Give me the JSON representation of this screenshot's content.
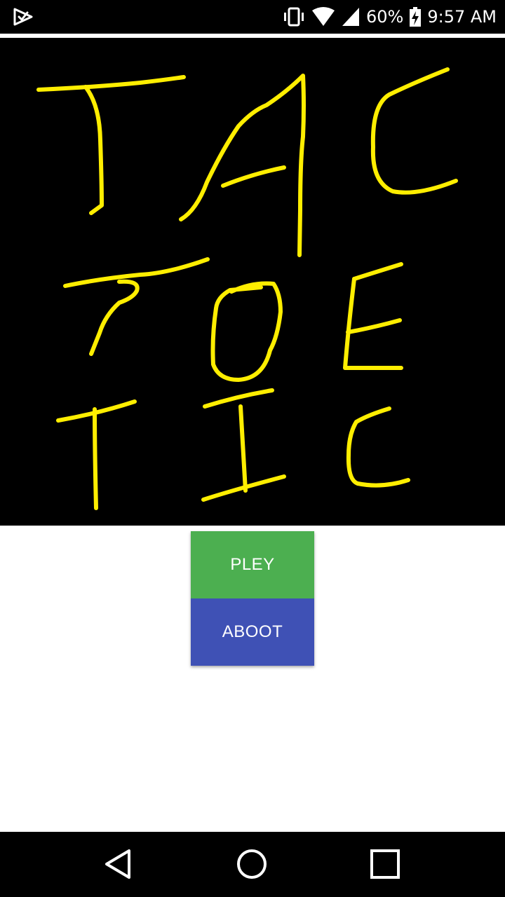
{
  "status_bar": {
    "battery_percent": "60%",
    "time": "9:57 AM",
    "icons": [
      "app-notification-icon",
      "vibrate-icon",
      "wifi-icon",
      "cell-signal-icon",
      "battery-charging-icon"
    ]
  },
  "title_art": {
    "rows": [
      {
        "letters": [
          "T",
          "A",
          "C"
        ]
      },
      {
        "letters": [
          "T",
          "O",
          "E"
        ]
      },
      {
        "letters": [
          "T",
          "I",
          "C"
        ]
      }
    ],
    "stroke_color": "#ffee00",
    "background": "#000000"
  },
  "menu": {
    "play_label": "PLEY",
    "about_label": "ABOOT",
    "play_color": "#4caf50",
    "about_color": "#3f51b5"
  },
  "nav_bar": {
    "buttons": [
      "back-icon",
      "home-icon",
      "recents-icon"
    ]
  }
}
